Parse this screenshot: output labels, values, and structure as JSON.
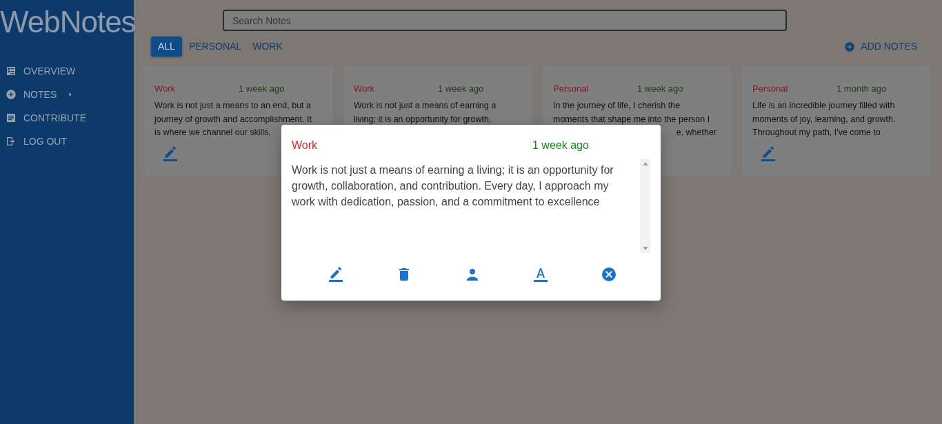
{
  "sidebar": {
    "logo": "WebNotes",
    "items": [
      {
        "kind": "overview",
        "label": "OVERVIEW",
        "expandable": false
      },
      {
        "kind": "notes",
        "label": "NOTES",
        "expandable": true
      },
      {
        "kind": "contribute",
        "label": "CONTRIBUTE",
        "expandable": false
      },
      {
        "kind": "logout",
        "label": "LOG OUT",
        "expandable": false
      }
    ]
  },
  "search": {
    "placeholder": "Search Notes"
  },
  "filters": [
    {
      "label": "ALL",
      "selected": true
    },
    {
      "label": "PERSONAL",
      "selected": false
    },
    {
      "label": "WORK",
      "selected": false
    }
  ],
  "add_button": "ADD NOTES",
  "notes": [
    {
      "category": "Work",
      "time": "1 week ago",
      "edit_button": true,
      "lines": [
        {
          "text": "Work is not just a means to an end, but a"
        },
        {
          "text": "journey of growth and accomplishment. It"
        },
        {
          "text": "is where we channel our skills,"
        }
      ]
    },
    {
      "category": "Work",
      "time": "1 week ago",
      "lines": [
        {
          "text": "Work is not just a means of earning a"
        },
        {
          "text": "living; it is an opportunity for growth,"
        }
      ]
    },
    {
      "category": "Personal",
      "time": "1 week ago",
      "lines": [
        {
          "text": "In the journey of life, I cherish the"
        },
        {
          "text": "moments that shape me into the person I"
        },
        {
          "text": "e, whether",
          "cut_start": true
        }
      ]
    },
    {
      "category": "Personal",
      "time": "1 month ago",
      "edit_button": true,
      "lines": [
        {
          "text": "Life is an incredible journey filled with"
        },
        {
          "text": "moments of joy, learning, and growth."
        },
        {
          "text": "Throughout my path, I've come to"
        }
      ]
    }
  ],
  "dialog": {
    "category": "Work",
    "time": "1 week ago",
    "text": "Work is not just a means of earning a living; it is an opportunity for growth, collaboration, and contribution. Every day, I approach my work with dedication, passion, and a commitment to excellence",
    "actions": [
      {
        "kind": "edit"
      },
      {
        "kind": "delete"
      },
      {
        "kind": "person"
      },
      {
        "kind": "font"
      },
      {
        "kind": "close"
      }
    ]
  }
}
